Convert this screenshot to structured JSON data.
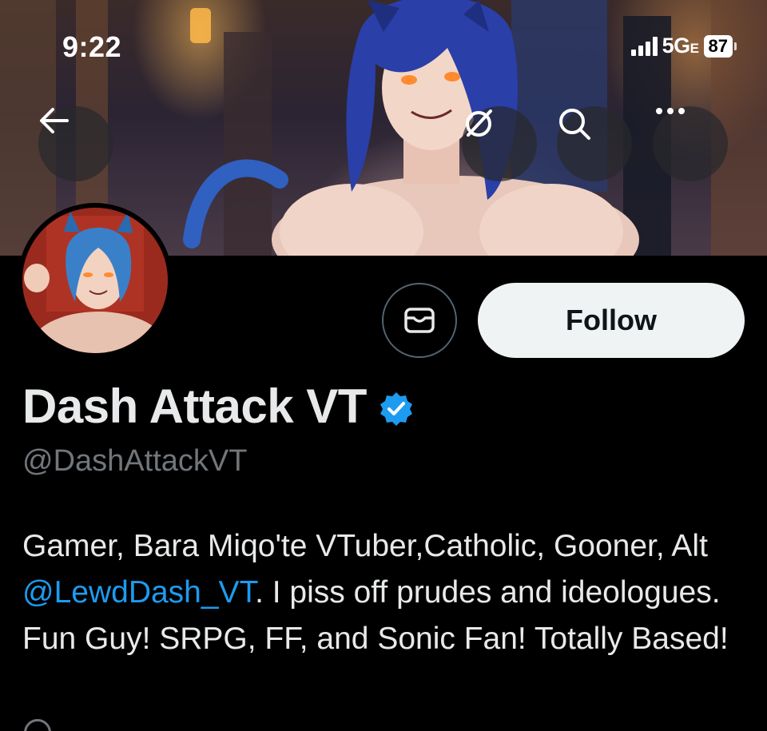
{
  "status_bar": {
    "time": "9:22",
    "network": "5G",
    "network_suffix": "E",
    "battery": "87"
  },
  "header": {
    "back_icon": "arrow-left-icon",
    "actions": [
      "grok-icon",
      "search-icon",
      "more-icon"
    ]
  },
  "profile": {
    "display_name": "Dash Attack VT",
    "verified": true,
    "handle": "@DashAttackVT",
    "follow_label": "Follow",
    "message_icon": "envelope-icon",
    "bio": {
      "part1": "Gamer, Bara Miqo'te VTuber,Catholic, Gooner, Alt ",
      "mention": "@LewdDash_VT",
      "part2": ". I piss off prudes and ideologues. Fun Guy! SRPG, FF, and Sonic Fan! Totally Based!"
    }
  },
  "colors": {
    "background": "#000000",
    "text": "#e7e9ea",
    "muted": "#71767b",
    "accent": "#1d9bf0",
    "follow_bg": "#eff3f4"
  }
}
